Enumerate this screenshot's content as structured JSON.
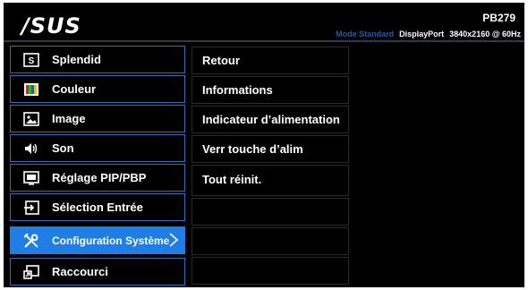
{
  "header": {
    "brand": "/SUS",
    "model": "PB279",
    "mode": "Mode Standard",
    "input": "DisplayPort",
    "resolution": "3840x2160 @ 60Hz"
  },
  "menu": {
    "items": [
      {
        "label": "Splendid",
        "icon": "splendid-icon"
      },
      {
        "label": "Couleur",
        "icon": "color-icon"
      },
      {
        "label": "Image",
        "icon": "image-icon"
      },
      {
        "label": "Son",
        "icon": "speaker-icon"
      },
      {
        "label": "Réglage PIP/PBP",
        "icon": "pip-icon"
      },
      {
        "label": "Sélection Entrée",
        "icon": "input-select-icon"
      },
      {
        "label": "Configuration Système",
        "icon": "tools-icon",
        "selected": true
      },
      {
        "label": "Raccourci",
        "icon": "shortcut-icon"
      }
    ]
  },
  "submenu": {
    "items": [
      {
        "label": "Retour"
      },
      {
        "label": "Informations"
      },
      {
        "label": "Indicateur d’alimentation"
      },
      {
        "label": "Verr touche d’alim"
      },
      {
        "label": "Tout réinit."
      },
      {
        "label": ""
      },
      {
        "label": ""
      },
      {
        "label": ""
      }
    ]
  },
  "colors": {
    "background": "#000000",
    "accent": "#1e7ee6",
    "menu_border": "#2a6fc0",
    "mode_text": "#2a5a9a"
  }
}
